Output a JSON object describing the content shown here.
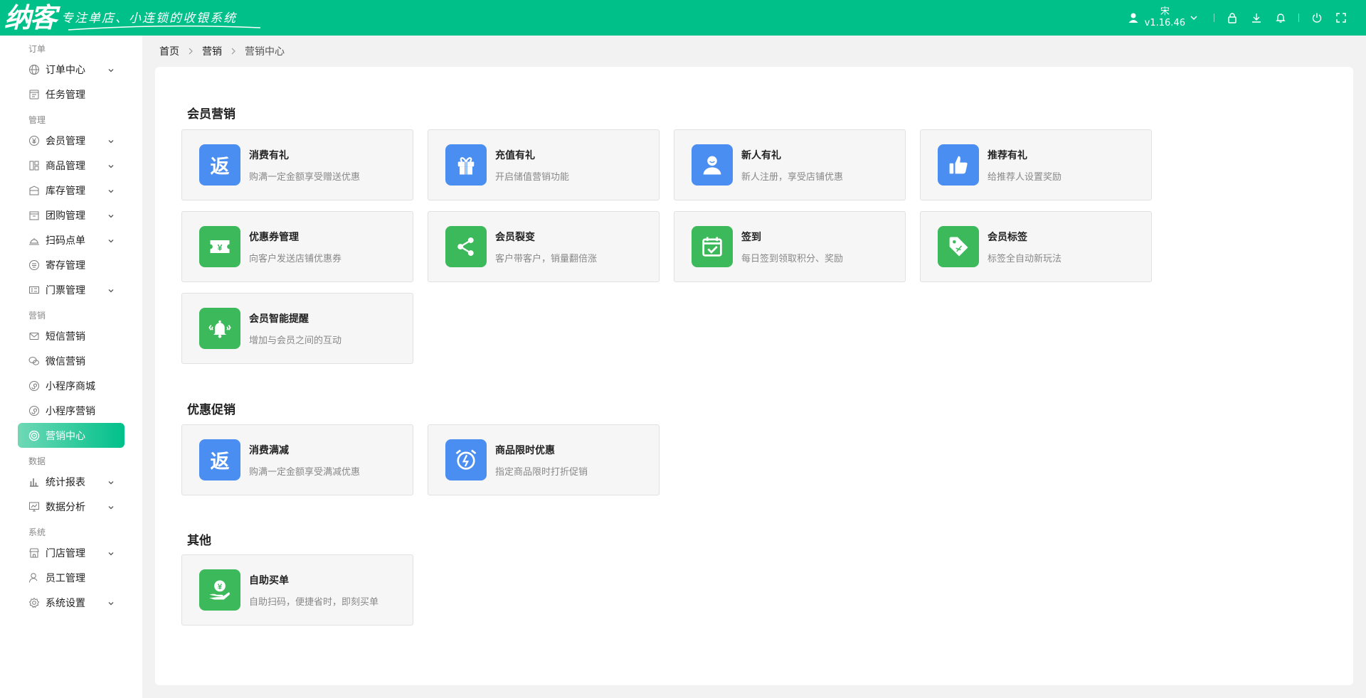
{
  "header": {
    "logo_text": "纳客",
    "slogan": "专注单店、小连锁的收银系统",
    "user_name": "宋",
    "version": "v1.16.46"
  },
  "breadcrumb": [
    "首页",
    "营销",
    "营销中心"
  ],
  "sidebar": {
    "groups": [
      {
        "label": "订单",
        "items": [
          {
            "label": "订单中心",
            "icon": "globe-icon",
            "chevron": true
          },
          {
            "label": "任务管理",
            "icon": "task-icon",
            "chevron": false
          }
        ]
      },
      {
        "label": "管理",
        "items": [
          {
            "label": "会员管理",
            "icon": "yuan-circle-icon",
            "chevron": true
          },
          {
            "label": "商品管理",
            "icon": "goods-icon",
            "chevron": true
          },
          {
            "label": "库存管理",
            "icon": "inventory-icon",
            "chevron": true
          },
          {
            "label": "团购管理",
            "icon": "groupbuy-icon",
            "chevron": true
          },
          {
            "label": "扫码点单",
            "icon": "bell-dish-icon",
            "chevron": true
          },
          {
            "label": "寄存管理",
            "icon": "storage-icon",
            "chevron": false
          },
          {
            "label": "门票管理",
            "icon": "ticket-icon",
            "chevron": true
          }
        ]
      },
      {
        "label": "营销",
        "items": [
          {
            "label": "短信营销",
            "icon": "mail-icon",
            "chevron": false
          },
          {
            "label": "微信营销",
            "icon": "wechat-icon",
            "chevron": false
          },
          {
            "label": "小程序商城",
            "icon": "miniprogram-icon",
            "chevron": false
          },
          {
            "label": "小程序营销",
            "icon": "miniprogram-icon",
            "chevron": false
          },
          {
            "label": "营销中心",
            "icon": "target-icon",
            "chevron": false,
            "active": true
          }
        ]
      },
      {
        "label": "数据",
        "items": [
          {
            "label": "统计报表",
            "icon": "bar-chart-icon",
            "chevron": true
          },
          {
            "label": "数据分析",
            "icon": "monitor-chart-icon",
            "chevron": true
          }
        ]
      },
      {
        "label": "系统",
        "items": [
          {
            "label": "门店管理",
            "icon": "store-icon",
            "chevron": true
          },
          {
            "label": "员工管理",
            "icon": "user-icon",
            "chevron": false
          },
          {
            "label": "系统设置",
            "icon": "gear-icon",
            "chevron": true
          }
        ]
      }
    ]
  },
  "sections": [
    {
      "title": "会员营销",
      "cards": [
        {
          "title": "消费有礼",
          "desc": "购满一定金额享受赠送优惠",
          "icon": "return-icon",
          "color": "#4b8ef1"
        },
        {
          "title": "充值有礼",
          "desc": "开启储值营销功能",
          "icon": "gift-icon",
          "color": "#4b8ef1"
        },
        {
          "title": "新人有礼",
          "desc": "新人注册，享受店铺优惠",
          "icon": "person-icon",
          "color": "#4b8ef1"
        },
        {
          "title": "推荐有礼",
          "desc": "给推荐人设置奖励",
          "icon": "thumbs-up-icon",
          "color": "#4b8ef1"
        },
        {
          "title": "优惠券管理",
          "desc": "向客户发送店铺优惠券",
          "icon": "coupon-icon",
          "color": "#3cb95a"
        },
        {
          "title": "会员裂变",
          "desc": "客户带客户，销量翻倍涨",
          "icon": "share-icon",
          "color": "#3cb95a"
        },
        {
          "title": "签到",
          "desc": "每日签到领取积分、奖励",
          "icon": "calendar-check-icon",
          "color": "#3cb95a"
        },
        {
          "title": "会员标签",
          "desc": "标签全自动新玩法",
          "icon": "tag-icon",
          "color": "#3cb95a"
        },
        {
          "title": "会员智能提醒",
          "desc": "增加与会员之间的互动",
          "icon": "ringing-bell-icon",
          "color": "#3cb95a"
        }
      ]
    },
    {
      "title": "优惠促销",
      "cards": [
        {
          "title": "消费满减",
          "desc": "购满一定金额享受满减优惠",
          "icon": "return-icon",
          "color": "#4b8ef1"
        },
        {
          "title": "商品限时优惠",
          "desc": "指定商品限时打折促销",
          "icon": "alarm-clock-icon",
          "color": "#4b8ef1"
        }
      ]
    },
    {
      "title": "其他",
      "cards": [
        {
          "title": "自助买单",
          "desc": "自助扫码，便捷省时，即刻买单",
          "icon": "hand-yuan-icon",
          "color": "#3cb95a"
        }
      ]
    }
  ]
}
